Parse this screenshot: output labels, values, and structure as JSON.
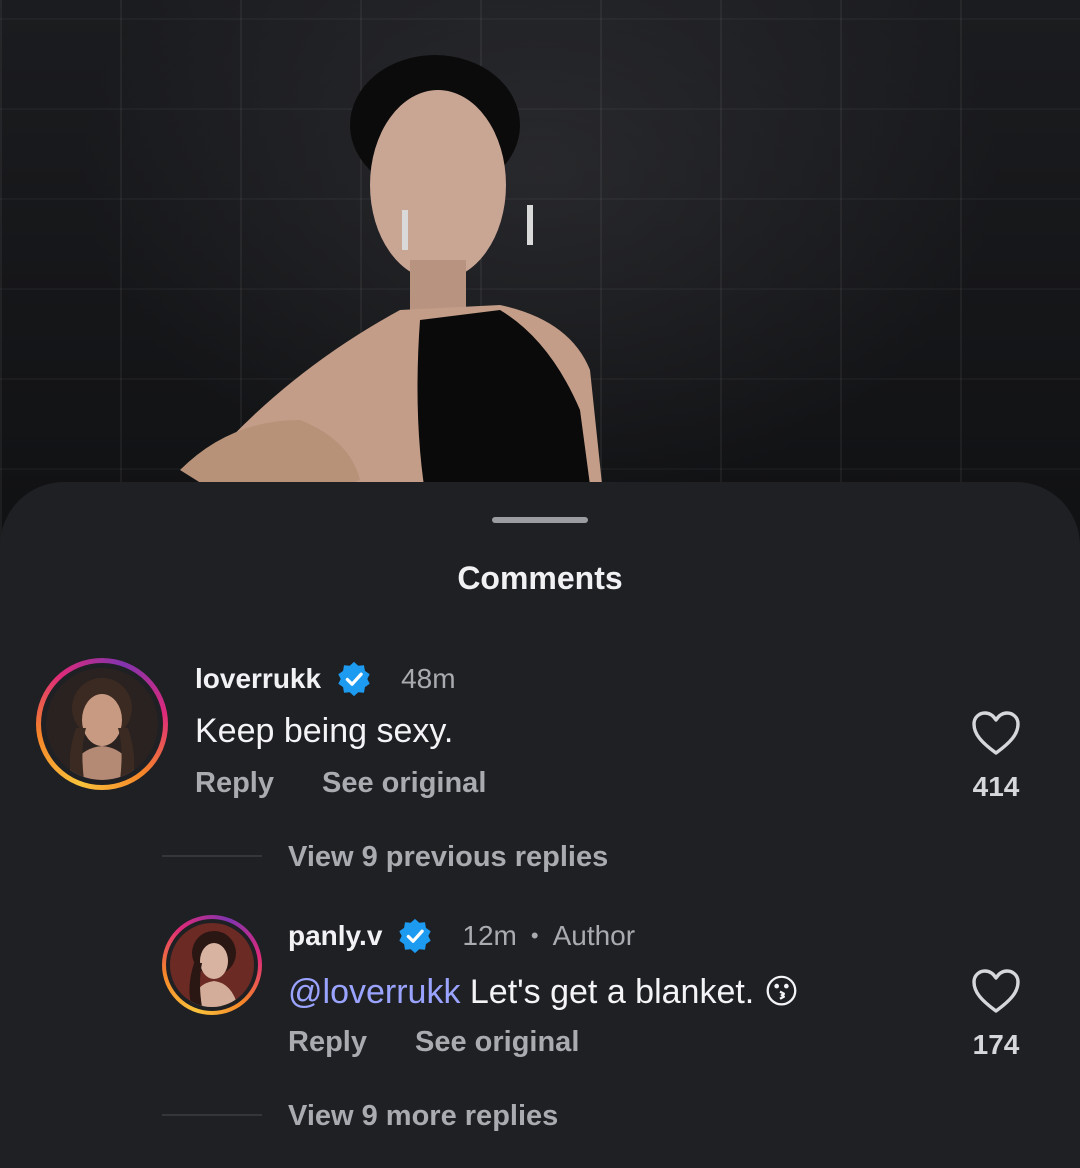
{
  "sheet": {
    "title": "Comments"
  },
  "comments": [
    {
      "username": "loverrukk",
      "verified": true,
      "time": "48m",
      "text": "Keep being sexy.",
      "actions": {
        "reply": "Reply",
        "see_original": "See original"
      },
      "likes": "414"
    }
  ],
  "threads": {
    "previous_replies": "View 9 previous replies",
    "more_replies": "View 9 more replies"
  },
  "reply": {
    "username": "panly.v",
    "verified": true,
    "time": "12m",
    "separator": "•",
    "author_label": "Author",
    "mention": "@loverrukk",
    "text": " Let's get a blanket.",
    "emoji": "😗",
    "actions": {
      "reply": "Reply",
      "see_original": "See original"
    },
    "likes": "174"
  },
  "colors": {
    "sheet_bg": "#1f2024",
    "mention": "#9aa4ff",
    "verified": "#1d9bf0"
  }
}
